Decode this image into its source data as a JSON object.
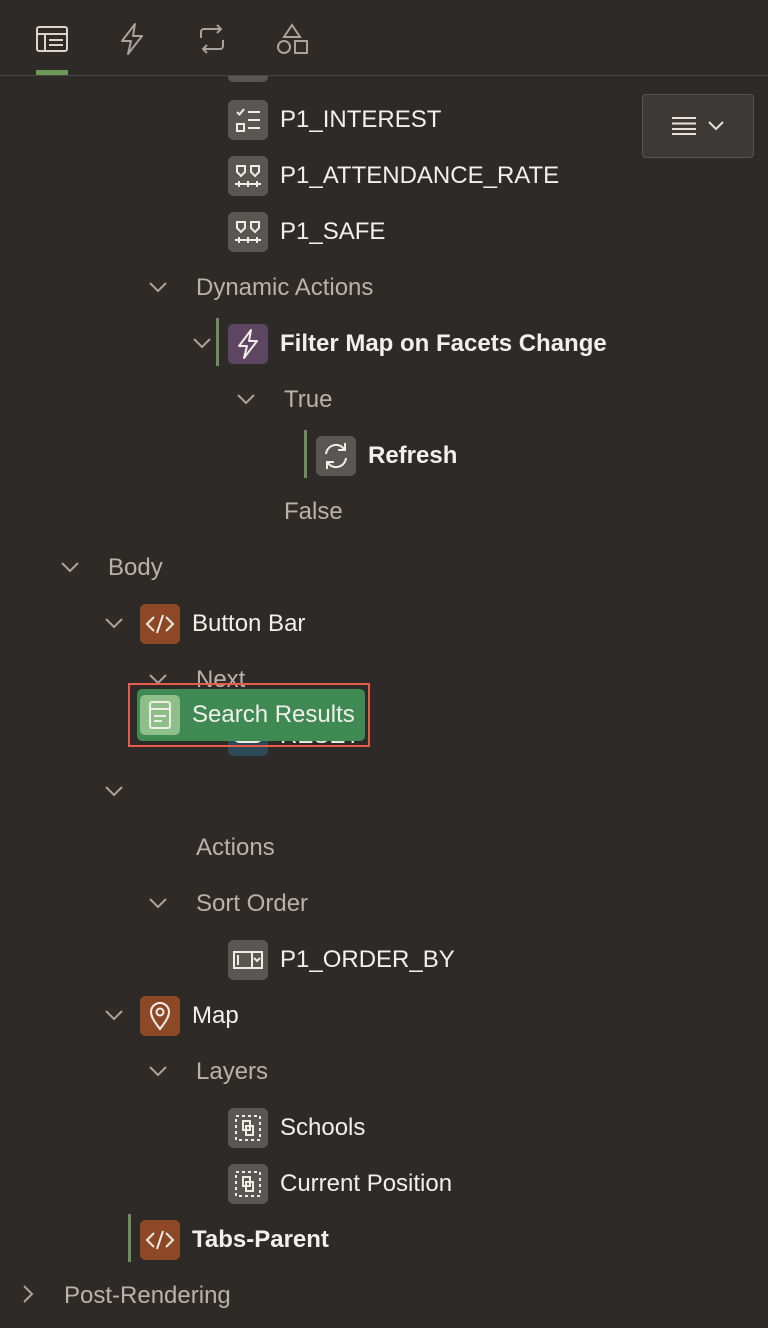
{
  "toolbar": {
    "tabs": [
      {
        "icon": "rendering-tree-icon",
        "active": true
      },
      {
        "icon": "lightning-icon",
        "active": false
      },
      {
        "icon": "processing-icon",
        "active": false
      },
      {
        "icon": "shared-components-icon",
        "active": false
      }
    ]
  },
  "menu_button": {
    "icon": "hamburger-icon"
  },
  "tree": {
    "items": {
      "p1_interest": "P1_INTEREST",
      "p1_attendance_rate": "P1_ATTENDANCE_RATE",
      "p1_safe": "P1_SAFE",
      "dynamic_actions": "Dynamic Actions",
      "filter_map": "Filter Map on Facets Change",
      "true_label": "True",
      "refresh": "Refresh",
      "false_label": "False",
      "body": "Body",
      "button_bar": "Button Bar",
      "next": "Next",
      "reset": "RESET",
      "search_results": "Search Results",
      "actions": "Actions",
      "sort_order": "Sort Order",
      "p1_order_by": "P1_ORDER_BY",
      "map": "Map",
      "layers": "Layers",
      "schools": "Schools",
      "current_position": "Current Position",
      "tabs_parent": "Tabs-Parent",
      "post_rendering": "Post-Rendering"
    }
  },
  "colors": {
    "background": "#2e2a27",
    "accent": "#6a9a55",
    "selection": "#3f8a52",
    "highlight_border": "#e85a4a"
  }
}
